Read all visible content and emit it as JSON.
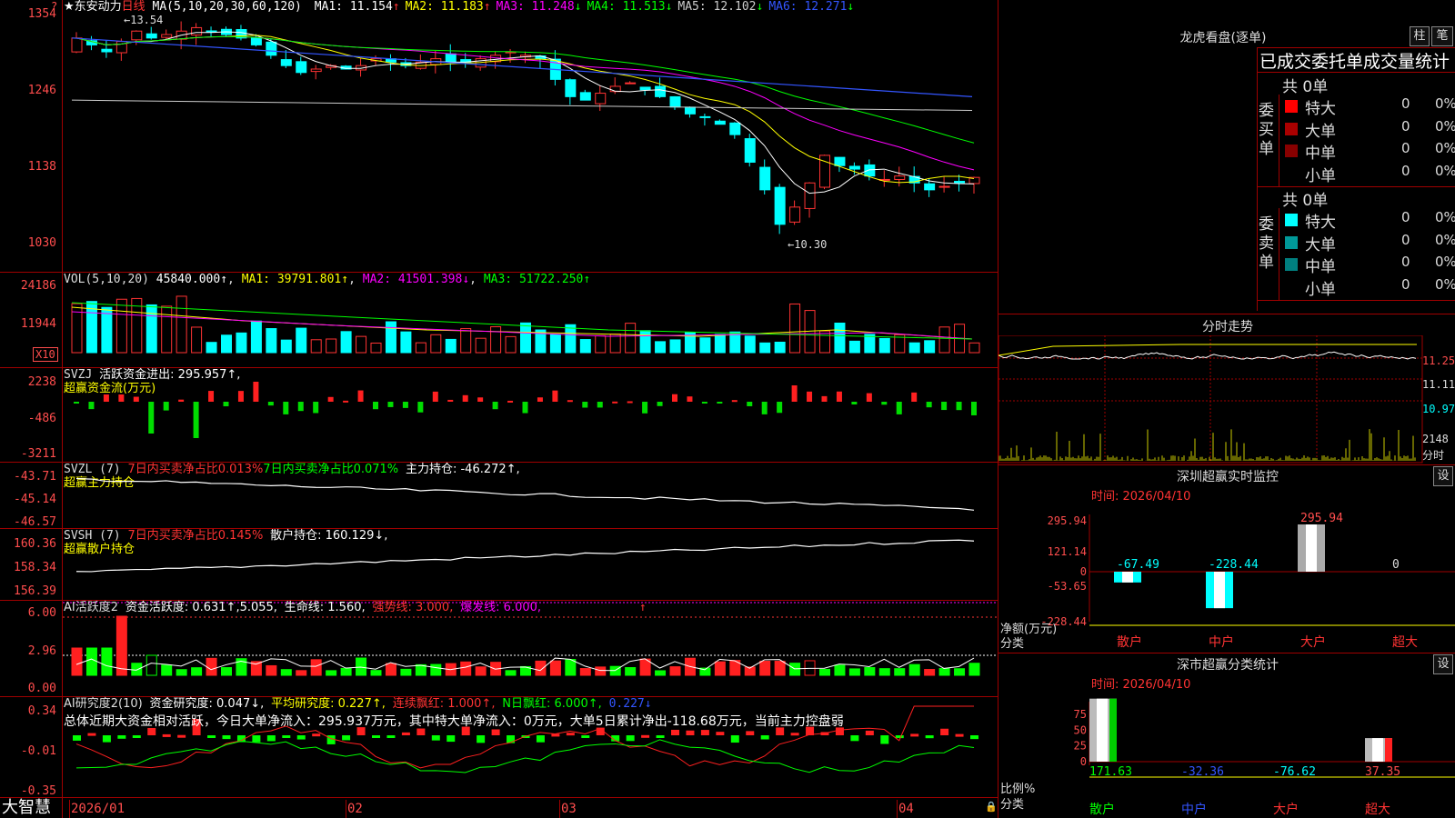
{
  "app": {
    "brand": "大智慧"
  },
  "stock": {
    "title": "★东安动力",
    "period": "日线",
    "ma_label": "MA(5,10,20,30,60,120)",
    "ma": [
      {
        "label": "MA1: 11.154",
        "arrow": "↑",
        "color": "#ffffff"
      },
      {
        "label": "MA2: 11.183",
        "arrow": "↑",
        "color": "#ffff00"
      },
      {
        "label": "MA3: 11.248",
        "arrow": "↓",
        "color": "#ff00ff"
      },
      {
        "label": "MA4: 11.513",
        "arrow": "↓",
        "color": "#00ff00"
      },
      {
        "label": "MA5: 12.102",
        "arrow": "↓",
        "color": "#cccccc"
      },
      {
        "label": "MA6: 12.271",
        "arrow": "↓",
        "color": "#3355ff"
      }
    ],
    "high_mark": "13.54",
    "low_mark": "←10.30",
    "y_labels": [
      "1354",
      "1246",
      "1138",
      "1030"
    ]
  },
  "vol": {
    "label": "VOL(5,10,20)",
    "value": "45840.000↑",
    "ma1": "MA1: 39791.801↑",
    "ma2": "MA2: 41501.398↓",
    "ma3": "MA3: 51722.250↑",
    "y_labels": [
      "24186",
      "11944"
    ],
    "unit": "X10"
  },
  "svzj": {
    "label": "SVZJ",
    "text": "活跃资金进出: 295.957↑,",
    "sub": "超赢资金流(万元)",
    "y_labels": [
      "2238",
      "-486",
      "-3211"
    ]
  },
  "svzl": {
    "label": "SVZL (7)",
    "t1": "7日内买卖净占比0.013%",
    "t2": "7日内买卖净占比0.071%",
    "t3": "主力持仓: -46.272↑,",
    "sub": "超赢主力持仓",
    "y_labels": [
      "-43.71",
      "-45.14",
      "-46.57"
    ]
  },
  "svsh": {
    "label": "SVSH (7)",
    "t1": "7日内买卖净占比0.145%",
    "t2": "散户持仓: 160.129↓,",
    "sub": "超赢散户持仓",
    "y_labels": [
      "160.36",
      "158.34",
      "156.39"
    ]
  },
  "ai1": {
    "label": "AI活跃度2",
    "t1": "资金活跃度: 0.631↑,5.055,",
    "t2": "生命线: 1.560,",
    "t3": "强势线: 3.000,",
    "t4": "爆发线: 6.000,",
    "arrow": "↑",
    "y_labels": [
      "6.00",
      "2.96",
      "0.00"
    ]
  },
  "ai2": {
    "label": "AI研究度2(10)",
    "t1": "资金研究度: 0.047↓,",
    "t2": "平均研究度: 0.227↑,",
    "t3": "连续飘红: 1.000↑,",
    "t4": "N日飘红: 6.000↑,",
    "t5": "0.227↓",
    "summary": "总体近期大资金相对活跃，今日大单净流入：295.937万元，其中特大单净流入：0万元，大单5日累计净出-118.68万元，当前主力控盘弱",
    "y_labels": [
      "0.34",
      "-0.01",
      "-0.35"
    ]
  },
  "xaxis": {
    "labels": [
      "2026/01",
      "02",
      "03",
      "04"
    ]
  },
  "lhb": {
    "title": "龙虎看盘(逐单)",
    "btn1": "柱",
    "btn2": "笔",
    "sub": "已成交委托单成交量统计",
    "buy": {
      "side": "委买单",
      "total": "共 0单",
      "rows": [
        {
          "name": "特大",
          "v": "0",
          "p": "0%",
          "color": "#ff0000"
        },
        {
          "name": "大单",
          "v": "0",
          "p": "0%",
          "color": "#aa0000"
        },
        {
          "name": "中单",
          "v": "0",
          "p": "0%",
          "color": "#880000"
        },
        {
          "name": "小单",
          "v": "0",
          "p": "0%",
          "color": ""
        }
      ]
    },
    "sell": {
      "side": "委卖单",
      "total": "共 0单",
      "rows": [
        {
          "name": "特大",
          "v": "0",
          "p": "0%",
          "color": "#00ffff"
        },
        {
          "name": "大单",
          "v": "0",
          "p": "0%",
          "color": "#009999"
        },
        {
          "name": "中单",
          "v": "0",
          "p": "0%",
          "color": "#008080"
        },
        {
          "name": "小单",
          "v": "0",
          "p": "0%",
          "color": ""
        }
      ]
    }
  },
  "fenshi": {
    "title": "分时走势",
    "y_labels": [
      "11.25",
      "11.11",
      "10.97"
    ],
    "vol_label": "2148",
    "vol_unit": "分时"
  },
  "sz_monitor": {
    "title": "深圳超赢实时监控",
    "btn": "设",
    "time": "时间: 2026/04/10",
    "y_labels": [
      "295.94",
      "121.14",
      "0",
      "-53.65",
      "-228.44"
    ],
    "ylab1": "净额(万元)",
    "ylab2": "分类",
    "chart_data": {
      "type": "bar",
      "categories": [
        "散户",
        "中户",
        "大户",
        "超大"
      ],
      "values": [
        -67.49,
        -228.44,
        295.94,
        0
      ],
      "value_labels": [
        "-67.49",
        "-228.44",
        "295.94",
        "0"
      ]
    }
  },
  "sz_class": {
    "title": "深市超赢分类统计",
    "btn": "设",
    "time": "时间: 2026/04/10",
    "y_labels": [
      "75",
      "50",
      "25",
      "0"
    ],
    "ylab1": "比例%",
    "ylab2": "分类",
    "chart_data": {
      "type": "bar",
      "categories": [
        "散户",
        "中户",
        "大户",
        "超大"
      ],
      "values": [
        171.63,
        -32.36,
        -76.62,
        37.35
      ],
      "value_labels": [
        "171.63",
        "-32.36",
        "-76.62",
        "37.35"
      ]
    }
  }
}
